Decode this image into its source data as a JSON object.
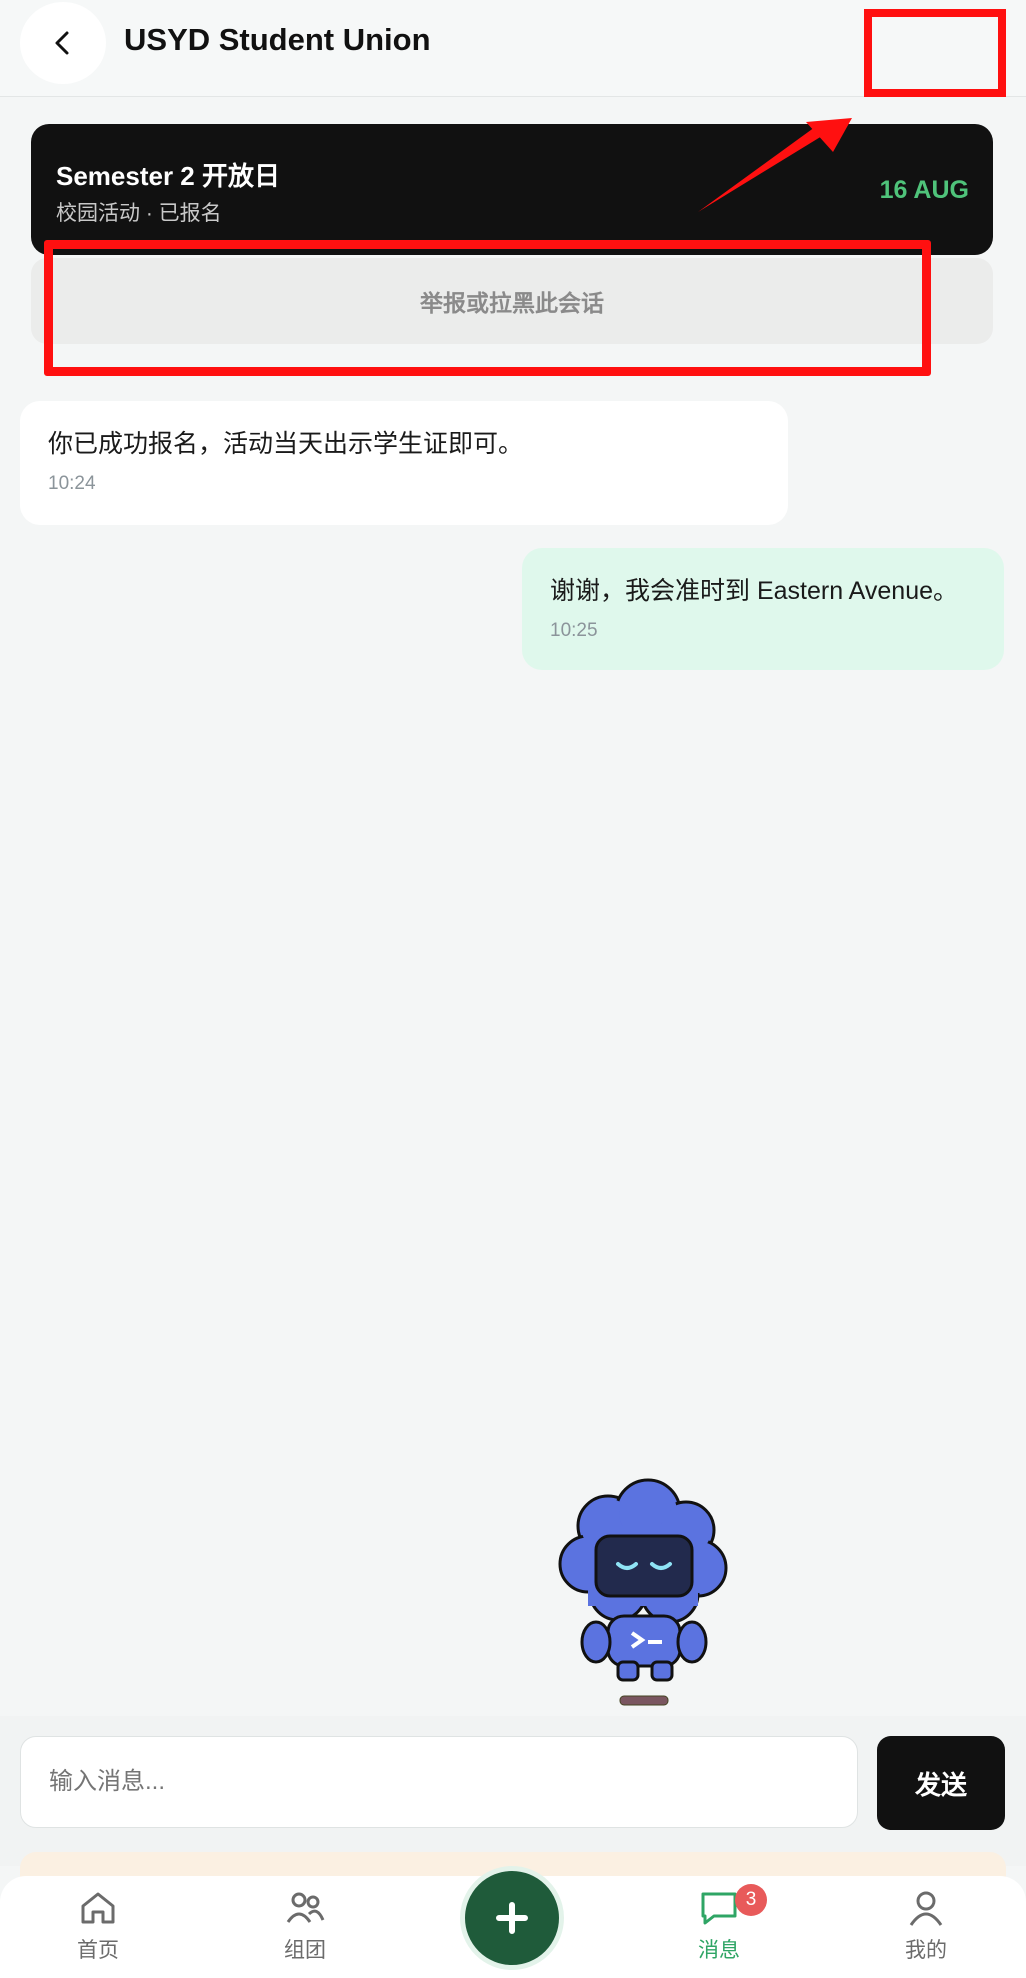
{
  "header": {
    "title": "USYD Student Union"
  },
  "event_card": {
    "title": "Semester 2 开放日",
    "subtitle": "校园活动 · 已报名",
    "date": "16 AUG"
  },
  "report_bar": {
    "label": "举报或拉黑此会话"
  },
  "messages": [
    {
      "direction": "incoming",
      "text": "你已成功报名，活动当天出示学生证即可。",
      "time": "10:24"
    },
    {
      "direction": "outgoing",
      "text": "谢谢，我会准时到 Eastern Avenue。",
      "time": "10:25"
    }
  ],
  "composer": {
    "placeholder": "输入消息...",
    "send_label": "发送"
  },
  "bottom_nav": {
    "items": [
      {
        "label": "首页",
        "icon": "home-icon",
        "active": false
      },
      {
        "label": "组团",
        "icon": "group-icon",
        "active": false
      },
      {
        "label": "消息",
        "icon": "chat-icon",
        "active": true,
        "badge": "3"
      },
      {
        "label": "我的",
        "icon": "profile-icon",
        "active": false
      }
    ],
    "fab_icon": "plus-icon"
  },
  "colors": {
    "accent_green": "#2fa565",
    "event_card_bg": "#111111",
    "annotation_red": "#ff1010",
    "outgoing_bubble": "#dff8ec"
  }
}
